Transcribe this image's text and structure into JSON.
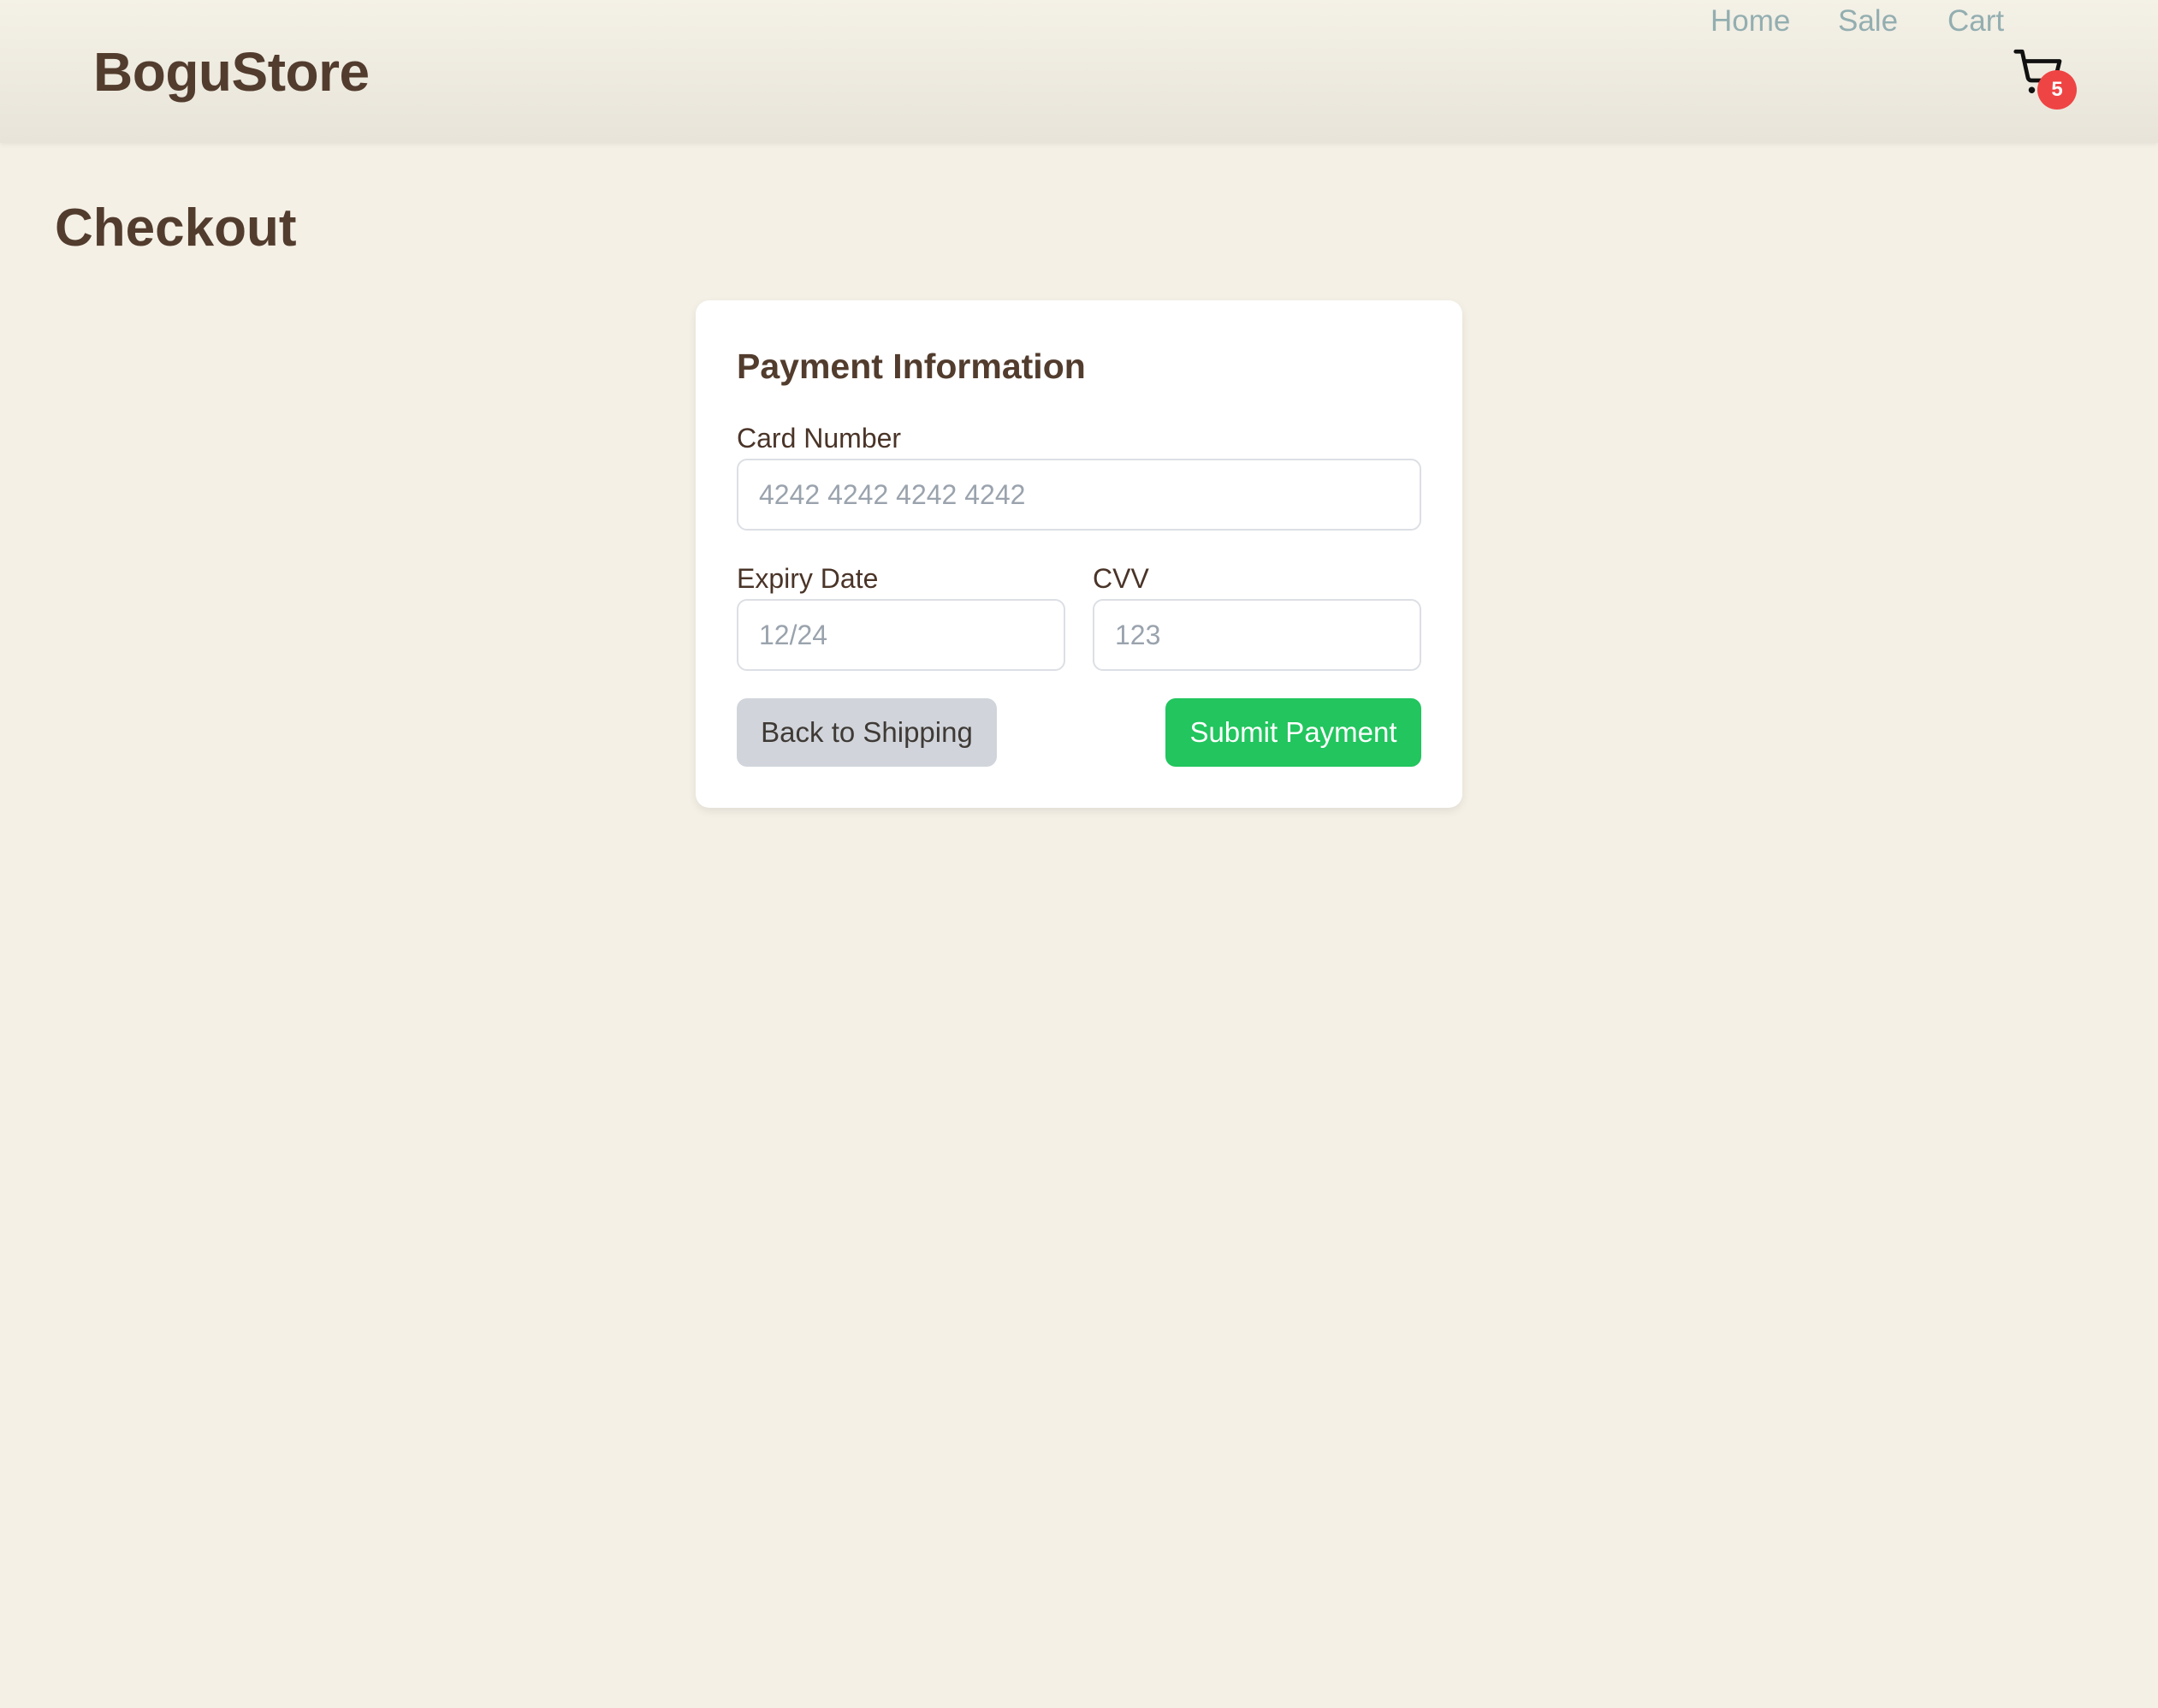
{
  "header": {
    "brand": "BoguStore",
    "nav": [
      {
        "label": "Home"
      },
      {
        "label": "Sale"
      },
      {
        "label": "Cart"
      }
    ],
    "cart": {
      "icon": "shopping-cart-icon",
      "badge_count": "5",
      "badge_color": "#ef4444"
    }
  },
  "page": {
    "title": "Checkout"
  },
  "payment": {
    "title": "Payment Information",
    "card_number": {
      "label": "Card Number",
      "value": "",
      "placeholder": "4242 4242 4242 4242"
    },
    "expiry": {
      "label": "Expiry Date",
      "value": "",
      "placeholder": "12/24"
    },
    "cvv": {
      "label": "CVV",
      "value": "",
      "placeholder": "123"
    },
    "back_button": "Back to Shipping",
    "submit_button": "Submit Payment",
    "submit_color": "#22c55e"
  },
  "colors": {
    "background": "#f4f0e6",
    "brand_text": "#523c2d",
    "nav_link": "#93aeb0"
  }
}
